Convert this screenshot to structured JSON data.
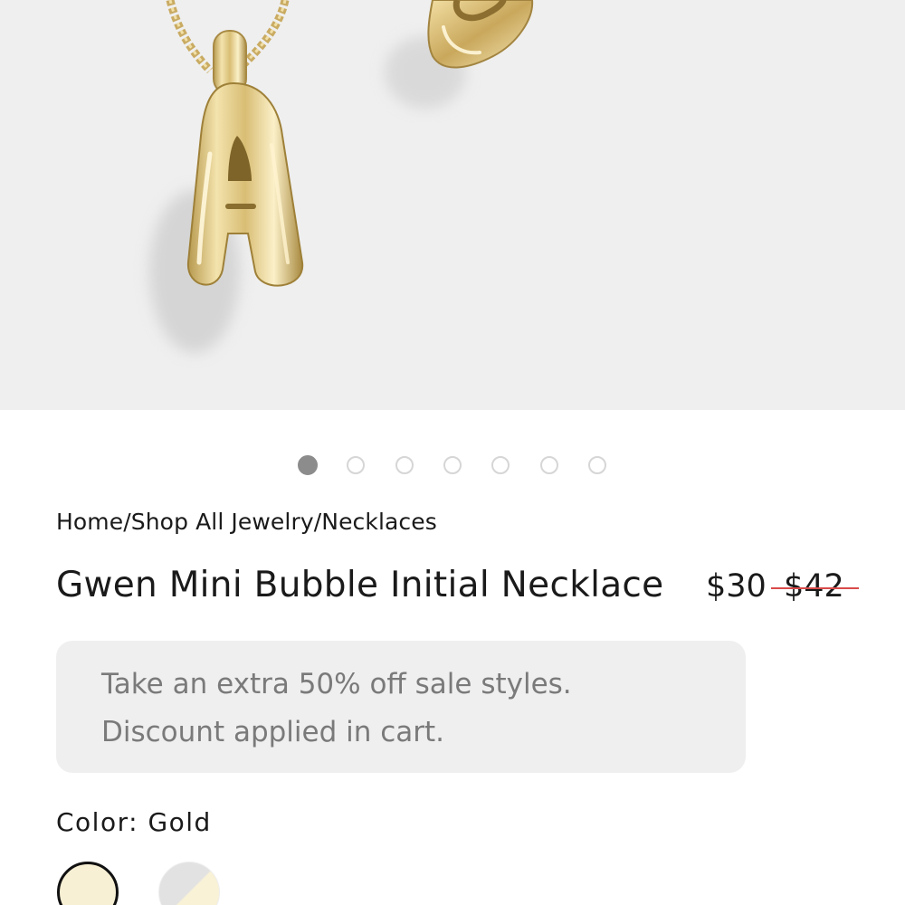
{
  "product_image": {
    "alt": "Gold bubble initial A pendant necklace"
  },
  "carousel": {
    "count": 7,
    "active_index": 0
  },
  "breadcrumb": {
    "home": "Home",
    "sep1": "/",
    "shop": "Shop All Jewelry",
    "sep2": "/",
    "category": "Necklaces"
  },
  "product": {
    "title": "Gwen Mini Bubble Initial Necklace",
    "price_sale": "$30",
    "price_original": "$42"
  },
  "promo": {
    "text": "Take an extra 50% off sale styles. Discount applied in cart."
  },
  "color": {
    "label": "Color: Gold",
    "swatches": [
      "Gold",
      "Gold/Silver"
    ],
    "selected": "Gold"
  },
  "colors": {
    "strike": "#d94a4a",
    "promo_bg": "#efefef",
    "hero_bg": "#efefef",
    "gold": "#e0c87a"
  }
}
